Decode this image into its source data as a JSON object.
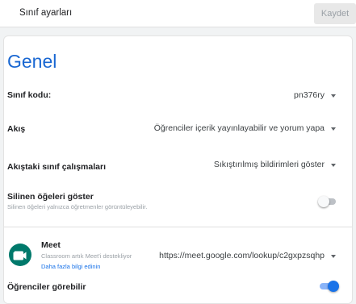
{
  "header": {
    "title": "Sınıf ayarları",
    "save_label": "Kaydet"
  },
  "section": {
    "heading": "Genel"
  },
  "settings": {
    "class_code": {
      "label": "Sınıf kodu:",
      "value": "pn376ry"
    },
    "stream": {
      "label": "Akış",
      "value": "Öğrenciler içerik yayınlayabilir ve yorum yapa"
    },
    "classwork_on_stream": {
      "label": "Akıştaki sınıf çalışmaları",
      "value": "Sıkıştırılmış bildirimleri göster"
    },
    "show_deleted": {
      "label": "Silinen öğeleri göster",
      "sublabel": "Silinen öğeleri yalnızca öğretmenler görüntüleyebilir.",
      "enabled": false
    },
    "meet": {
      "title": "Meet",
      "description": "Classroom artık Meet'i destekliyor",
      "learn_more": "Daha fazla bilgi edinin",
      "link": "https://meet.google.com/lookup/c2gxpzsqhp"
    },
    "students_visible": {
      "label": "Öğrenciler görebilir",
      "enabled": true
    }
  },
  "icons": {
    "dropdown": "chevron-down-icon",
    "meet": "meet-icon"
  },
  "colors": {
    "accent": "#1967d2",
    "toggle_on": "#1a73e8",
    "meet_green": "#00796b",
    "link": "#1a73e8"
  }
}
